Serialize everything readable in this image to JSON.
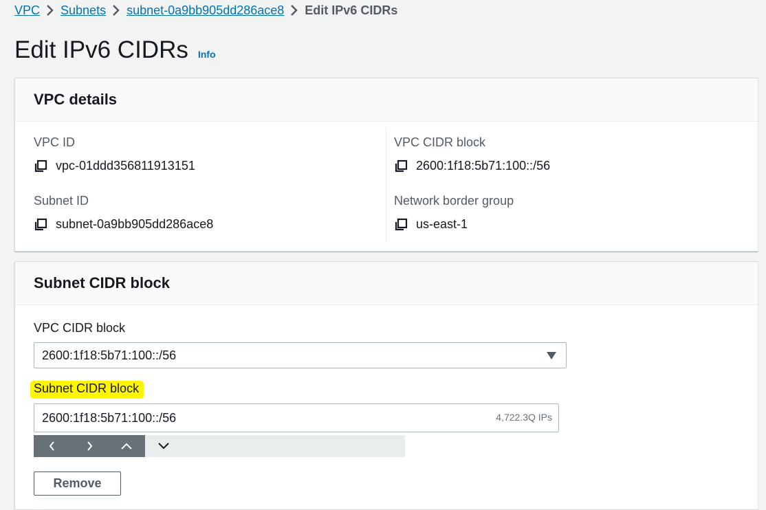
{
  "breadcrumb": {
    "items": [
      "VPC",
      "Subnets",
      "subnet-0a9bb905dd286ace8"
    ],
    "current": "Edit IPv6 CIDRs"
  },
  "page": {
    "title": "Edit IPv6 CIDRs",
    "info_label": "Info"
  },
  "vpc_details": {
    "heading": "VPC details",
    "vpc_id_label": "VPC ID",
    "vpc_id": "vpc-01ddd356811913151",
    "subnet_id_label": "Subnet ID",
    "subnet_id": "subnet-0a9bb905dd286ace8",
    "vpc_cidr_label": "VPC CIDR block",
    "vpc_cidr": "2600:1f18:5b71:100::/56",
    "border_group_label": "Network border group",
    "border_group": "us-east-1"
  },
  "subnet_cidr": {
    "heading": "Subnet CIDR block",
    "vpc_cidr_label": "VPC CIDR block",
    "vpc_cidr_selected": "2600:1f18:5b71:100::/56",
    "subnet_cidr_label": "Subnet CIDR block",
    "subnet_cidr_value": "2600:1f18:5b71:100::/56",
    "ip_count": "4,722.3Q IPs",
    "remove_label": "Remove"
  },
  "icons": {
    "copy": "copy-icon",
    "breadcrumb_separator": "chevron-right-icon",
    "dropdown": "caret-down-icon",
    "stepper": [
      "chevron-left-icon",
      "chevron-right-icon",
      "chevron-up-icon",
      "chevron-down-icon"
    ]
  },
  "colors": {
    "link": "#0073bb",
    "highlight": "#fff500",
    "stepper_dark": "#687078",
    "stepper_bg": "#eaeded"
  }
}
